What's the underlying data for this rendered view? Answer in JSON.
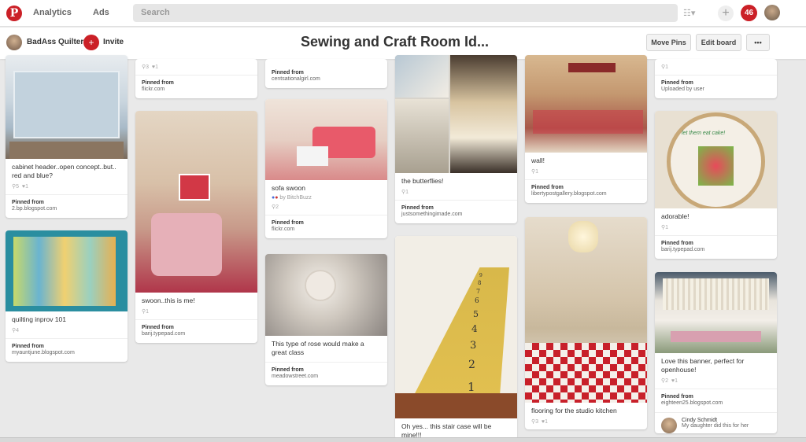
{
  "topbar": {
    "logo": "P",
    "nav": [
      "Analytics",
      "Ads"
    ],
    "search_placeholder": "Search",
    "notifications": "46"
  },
  "board": {
    "owner": "BadAss Quilter",
    "invite": "Invite",
    "title": "Sewing and Craft Room Id...",
    "buttons": [
      "Move Pins",
      "Edit board",
      "•••"
    ]
  },
  "pins": [
    {
      "desc": "",
      "repins": "3",
      "likes": "1",
      "src_label": "Pinned from",
      "src": "flickr.com"
    },
    {
      "desc": "",
      "repins": "",
      "likes": "",
      "src_label": "Pinned from",
      "src": "centsationalgirl.com"
    },
    {
      "desc": "",
      "repins": "1",
      "likes": "",
      "src_label": "Pinned from",
      "src": "Uploaded by user"
    },
    {
      "desc": "cabinet header..open concept..but.. red and blue?",
      "repins": "5",
      "likes": "1",
      "src_label": "Pinned from",
      "src": "2.bp.blogspot.com"
    },
    {
      "desc": "quilting inprov 101",
      "repins": "4",
      "likes": "",
      "src_label": "Pinned from",
      "src": "myauntjune.blogspot.com"
    },
    {
      "desc": "swoon..this is me!",
      "repins": "1",
      "likes": "",
      "src_label": "Pinned from",
      "src": "barij.typepad.com"
    },
    {
      "desc": "sofa swoon",
      "by": "by BitchBuzz",
      "repins": "2",
      "likes": "",
      "src_label": "Pinned from",
      "src": "flickr.com"
    },
    {
      "desc": "This type of rose would make a great class",
      "repins": "",
      "likes": "",
      "src_label": "Pinned from",
      "src": "meadowstreet.com"
    },
    {
      "desc": "the butterflies!",
      "repins": "1",
      "likes": "",
      "src_label": "Pinned from",
      "src": "justsomethingimade.com"
    },
    {
      "desc": "Oh yes... this stair case will be mine!!!",
      "repins": "",
      "likes": "",
      "src_label": "",
      "src": ""
    },
    {
      "desc": "wall!",
      "repins": "1",
      "likes": "",
      "src_label": "Pinned from",
      "src": "libertypostgallery.blogspot.com"
    },
    {
      "desc": "flooring for the studio kitchen",
      "repins": "3",
      "likes": "1",
      "src_label": "",
      "src": ""
    },
    {
      "desc": "adorable!",
      "repins": "1",
      "likes": "",
      "src_label": "Pinned from",
      "src": "barij.typepad.com"
    },
    {
      "desc": "Love this banner, perfect for openhouse!",
      "repins": "2",
      "likes": "1",
      "src_label": "Pinned from",
      "src": "eighteen25.blogspot.com",
      "commenter": "Cindy Schmidt",
      "comment": "My daughter did this for her"
    }
  ],
  "stair_numbers": [
    "1",
    "2",
    "3",
    "4",
    "5",
    "6",
    "7",
    "8",
    "9"
  ],
  "embroidery_text": "let them eat cake!",
  "colors": {
    "brand": "#cb2027",
    "background": "#e9e9e9"
  }
}
